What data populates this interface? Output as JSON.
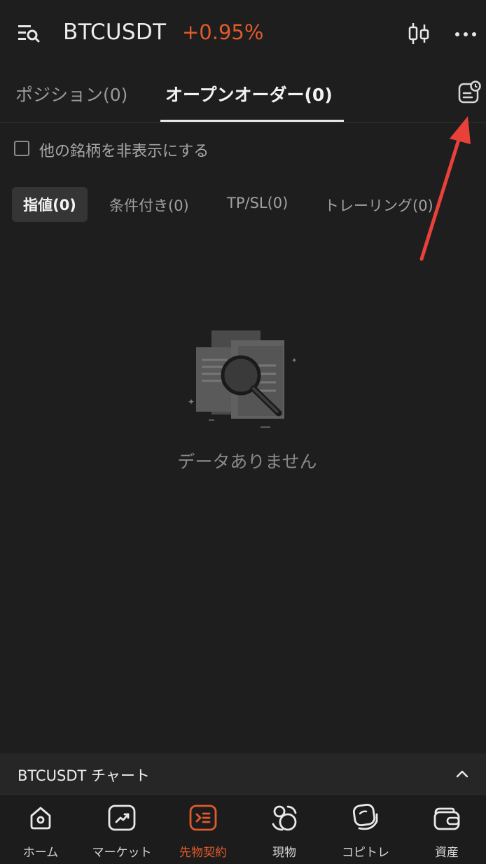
{
  "header": {
    "symbol": "BTCUSDT",
    "change": "+0.95%",
    "change_color": "#e05a2b",
    "icons": [
      "menu-search-icon",
      "candlestick-chart-icon",
      "more-dots-icon"
    ]
  },
  "tabs": {
    "positions": "ポジション(0)",
    "open_orders": "オープンオーダー(0)",
    "active": "open_orders",
    "history_icon": "order-history-icon"
  },
  "filter": {
    "hide_other_symbols": "他の銘柄を非表示にする",
    "checked": false
  },
  "order_types": {
    "limit": "指値(0)",
    "conditional": "条件付き(0)",
    "tpsl": "TP/SL(0)",
    "trailing": "トレーリング(0)",
    "active": "limit"
  },
  "empty_state": {
    "message": "データありません",
    "icon": "document-search-icon"
  },
  "chart_bar": {
    "label": "BTCUSDT チャート",
    "icon": "chevron-up-icon"
  },
  "bottom_nav": {
    "items": [
      {
        "label": "ホーム",
        "icon": "home-icon"
      },
      {
        "label": "マーケット",
        "icon": "market-chart-icon"
      },
      {
        "label": "先物契約",
        "icon": "futures-icon"
      },
      {
        "label": "現物",
        "icon": "spot-icon"
      },
      {
        "label": "コピトレ",
        "icon": "copy-trade-icon"
      },
      {
        "label": "資産",
        "icon": "wallet-icon"
      }
    ],
    "active_index": 2,
    "active_color": "#e05a2b"
  },
  "annotation": {
    "arrow_color": "#e8413a"
  }
}
